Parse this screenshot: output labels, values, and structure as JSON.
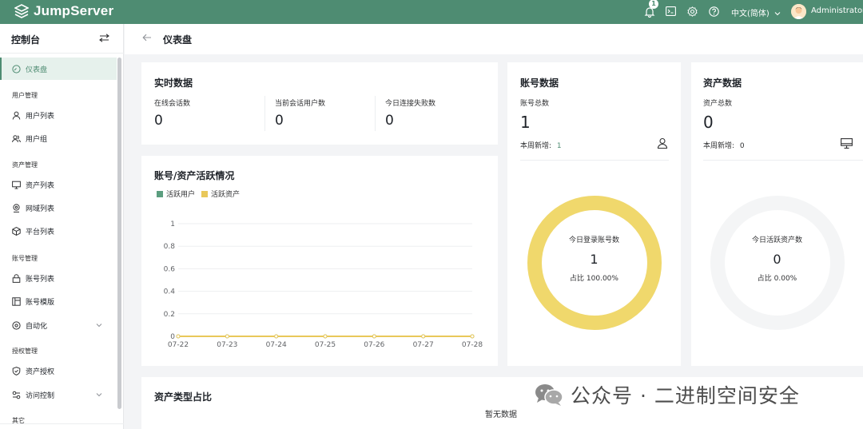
{
  "app": {
    "name": "JumpServer"
  },
  "header": {
    "notification_count": "1",
    "language": "中文(简体)",
    "username": "Administrator",
    "icons": [
      "bell-icon",
      "terminal-icon",
      "settings-icon",
      "help-icon",
      "chevron-down-icon",
      "avatar"
    ]
  },
  "sidebar": {
    "title": "控制台",
    "active": "仪表盘",
    "items": [
      {
        "label": "仪表盘",
        "icon": "dashboard-icon"
      },
      {
        "group": "用户管理"
      },
      {
        "label": "用户列表",
        "icon": "user-icon"
      },
      {
        "label": "用户组",
        "icon": "users-icon"
      },
      {
        "group": "资产管理"
      },
      {
        "label": "资产列表",
        "icon": "monitor-icon"
      },
      {
        "label": "网域列表",
        "icon": "location-icon"
      },
      {
        "label": "平台列表",
        "icon": "cube-icon"
      },
      {
        "group": "账号管理"
      },
      {
        "label": "账号列表",
        "icon": "lock-icon"
      },
      {
        "label": "账号模版",
        "icon": "template-icon"
      },
      {
        "label": "自动化",
        "icon": "automation-icon",
        "expandable": true
      },
      {
        "group": "授权管理"
      },
      {
        "label": "资产授权",
        "icon": "shield-icon"
      },
      {
        "label": "访问控制",
        "icon": "access-control-icon",
        "expandable": true
      },
      {
        "group": "其它"
      }
    ]
  },
  "breadcrumb": {
    "title": "仪表盘"
  },
  "realtime": {
    "title": "实时数据",
    "stats": [
      {
        "label": "在线会话数",
        "value": "0"
      },
      {
        "label": "当前会话用户数",
        "value": "0"
      },
      {
        "label": "今日连接失败数",
        "value": "0"
      }
    ]
  },
  "accounts": {
    "title": "账号数据",
    "total_label": "账号总数",
    "total": "1",
    "weekly_label": "本周新增:",
    "weekly": "1",
    "donut_label": "今日登录账号数",
    "donut_value": "1",
    "ratio_label": "占比 100.00%",
    "ratio": 1.0
  },
  "assets": {
    "title": "资产数据",
    "total_label": "资产总数",
    "total": "0",
    "weekly_label": "本周新增:",
    "weekly": "0",
    "donut_label": "今日活跃资产数",
    "donut_value": "0",
    "ratio_label": "占比 0.00%",
    "ratio": 0.0
  },
  "activity": {
    "title": "账号/资产活跃情况",
    "chart_data": {
      "type": "line",
      "title": "账号/资产活跃情况",
      "categories": [
        "07-22",
        "07-23",
        "07-24",
        "07-25",
        "07-26",
        "07-27",
        "07-28"
      ],
      "series": [
        {
          "name": "活跃用户",
          "values": [
            0,
            0,
            0,
            0,
            0,
            0,
            0
          ],
          "color": "#5b9e7f"
        },
        {
          "name": "活跃资产",
          "values": [
            0,
            0,
            0,
            0,
            0,
            0,
            0
          ],
          "color": "#e9c85a"
        }
      ],
      "yticks": [
        "0",
        "0.2",
        "0.4",
        "0.6",
        "0.8",
        "1"
      ],
      "ylim": [
        0,
        1
      ],
      "legend": "top-left",
      "grid": true
    }
  },
  "asset_types": {
    "title": "资产类型占比",
    "empty": "暂无数据"
  },
  "colors": {
    "brand": "#4e8c72",
    "account_donut": "#f0d86c",
    "asset_donut": "#f4f5f6"
  },
  "watermark": {
    "text": "公众号 · 二进制空间安全"
  }
}
